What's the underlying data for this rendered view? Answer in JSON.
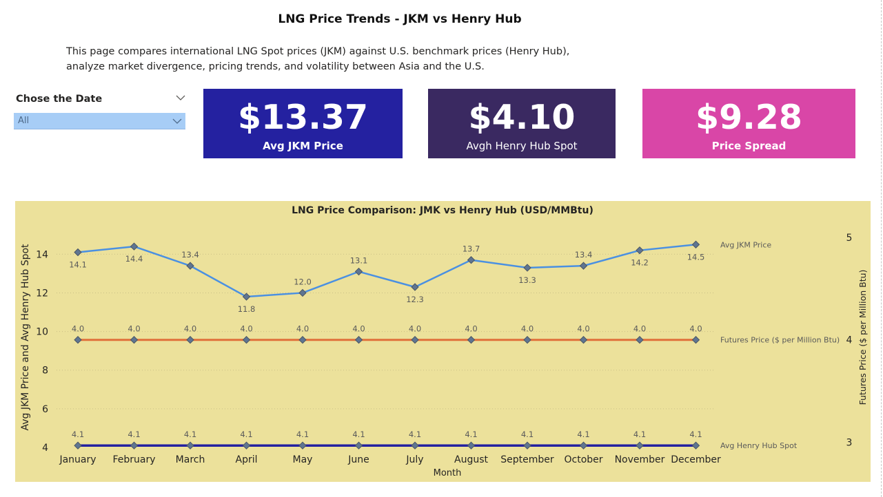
{
  "page": {
    "title": "LNG Price Trends - JKM vs Henry Hub",
    "description_line1": "This page compares international LNG Spot prices (JKM) against U.S. benchmark prices (Henry Hub),",
    "description_line2": "analyze market divergence, pricing trends, and volatility between Asia and the U.S."
  },
  "slicer": {
    "title": "Chose the Date",
    "value": "All",
    "icons": [
      "chevron-down-icon",
      "chevron-down-icon"
    ]
  },
  "cards": [
    {
      "value": "$13.37",
      "label": "Avg JKM Price",
      "color": "#2421a0"
    },
    {
      "value": "$4.10",
      "label": "Avgh  Henry Hub Spot",
      "color": "#3a2961"
    },
    {
      "value": "$9.28",
      "label": "Price Spread",
      "color": "#d946a7"
    }
  ],
  "chart_data": {
    "type": "line",
    "title": "LNG Price Comparison: JMK vs Henry Hub (USD/MMBtu)",
    "xlabel": "Month",
    "ylabel": "Avg JKM Price and Avg Henry Hub Spot",
    "y2label": "Futures Price ($ per Million Btu)",
    "categories": [
      "January",
      "February",
      "March",
      "April",
      "May",
      "June",
      "July",
      "August",
      "September",
      "October",
      "November",
      "December"
    ],
    "ylim": [
      4,
      15.4
    ],
    "yticks": [
      4,
      6,
      8,
      10,
      12,
      14
    ],
    "y2lim": [
      2.95,
      5.1
    ],
    "y2ticks": [
      3,
      4,
      5
    ],
    "grid": true,
    "legend": "right",
    "background": "#ece19b",
    "series": [
      {
        "name": "Avg JKM Price",
        "axis": "left",
        "color": "#4a90e2",
        "values": [
          14.1,
          14.4,
          13.4,
          11.8,
          12.0,
          13.1,
          12.3,
          13.7,
          13.3,
          13.4,
          14.2,
          14.5
        ],
        "labels": [
          "14.1",
          "14.4",
          "13.4",
          "11.8",
          "12.0",
          "13.1",
          "12.3",
          "13.7",
          "13.3",
          "13.4",
          "14.2",
          "14.5"
        ],
        "label_pos": [
          "below",
          "below",
          "above",
          "below",
          "above",
          "above",
          "below",
          "above",
          "below",
          "above",
          "below",
          "below"
        ]
      },
      {
        "name": "Futures Price ($ per Million Btu)",
        "axis": "right",
        "color": "#e0703a",
        "values": [
          4.0,
          4.0,
          4.0,
          4.0,
          4.0,
          4.0,
          4.0,
          4.0,
          4.0,
          4.0,
          4.0,
          4.0
        ],
        "labels": [
          "4.0",
          "4.0",
          "4.0",
          "4.0",
          "4.0",
          "4.0",
          "4.0",
          "4.0",
          "4.0",
          "4.0",
          "4.0",
          "4.0"
        ],
        "label_pos": [
          "above",
          "above",
          "above",
          "above",
          "above",
          "above",
          "above",
          "above",
          "above",
          "above",
          "above",
          "above"
        ]
      },
      {
        "name": "Avg Henry Hub Spot",
        "axis": "left",
        "color": "#2421a0",
        "values": [
          4.1,
          4.1,
          4.1,
          4.1,
          4.1,
          4.1,
          4.1,
          4.1,
          4.1,
          4.1,
          4.1,
          4.1
        ],
        "labels": [
          "4.1",
          "4.1",
          "4.1",
          "4.1",
          "4.1",
          "4.1",
          "4.1",
          "4.1",
          "4.1",
          "4.1",
          "4.1",
          "4.1"
        ],
        "label_pos": [
          "above",
          "above",
          "above",
          "above",
          "above",
          "above",
          "above",
          "above",
          "above",
          "above",
          "above",
          "above"
        ]
      }
    ]
  }
}
